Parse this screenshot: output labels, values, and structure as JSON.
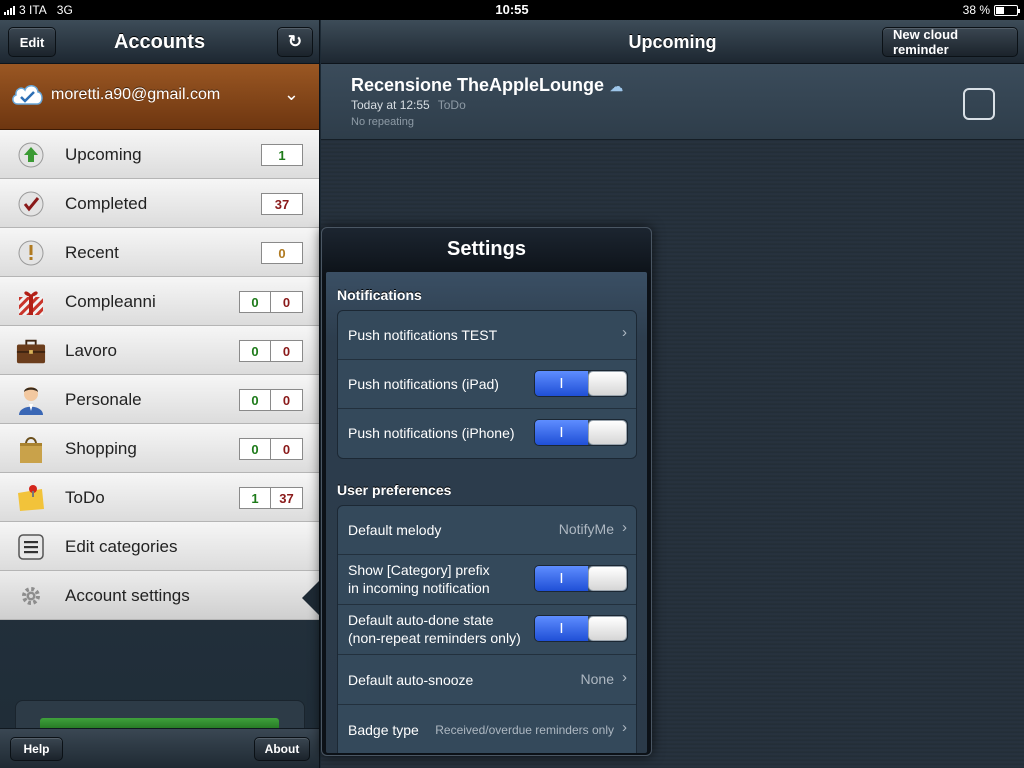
{
  "statusbar": {
    "carrier": "3 ITA",
    "network": "3G",
    "time": "10:55",
    "battery": "38 %",
    "battery_level": 0.38
  },
  "sidebar": {
    "title": "Accounts",
    "edit_label": "Edit",
    "refresh_icon": "↻",
    "account_email": "moretti.a90@gmail.com",
    "account_chevron": "⌄",
    "categories": [
      {
        "label": "Upcoming",
        "counts": [
          "1"
        ]
      },
      {
        "label": "Completed",
        "counts": [
          "37"
        ]
      },
      {
        "label": "Recent",
        "counts": [
          "0"
        ]
      },
      {
        "label": "Compleanni",
        "counts": [
          "0",
          "0"
        ]
      },
      {
        "label": "Lavoro",
        "counts": [
          "0",
          "0"
        ]
      },
      {
        "label": "Personale",
        "counts": [
          "0",
          "0"
        ]
      },
      {
        "label": "Shopping",
        "counts": [
          "0",
          "0"
        ]
      },
      {
        "label": "ToDo",
        "counts": [
          "1",
          "37"
        ]
      },
      {
        "label": "Edit categories"
      },
      {
        "label": "Account settings"
      }
    ],
    "help_label": "Help",
    "about_label": "About"
  },
  "main": {
    "title": "Upcoming",
    "new_cloud_label": "New cloud reminder",
    "reminder": {
      "title": "Recensione TheAppleLounge",
      "cloud_icon": "☁",
      "time": "Today at 12:55",
      "category": "ToDo",
      "repeat": "No repeating"
    }
  },
  "settings": {
    "title": "Settings",
    "notifications_header": "Notifications",
    "push_test": "Push notifications TEST",
    "push_ipad": "Push notifications (iPad)",
    "push_iphone": "Push notifications (iPhone)",
    "prefs_header": "User preferences",
    "default_melody": "Default melody",
    "default_melody_value": "NotifyMe",
    "prefix_line1": "Show [Category] prefix",
    "prefix_line2": "in incoming notification",
    "autodone_line1": "Default auto-done state",
    "autodone_line2": "(non-repeat reminders only)",
    "autosnooze": "Default auto-snooze",
    "autosnooze_value": "None",
    "badge": "Badge type",
    "badge_value": "Received/overdue reminders only",
    "toggle_on": "I",
    "chevron": "›"
  }
}
